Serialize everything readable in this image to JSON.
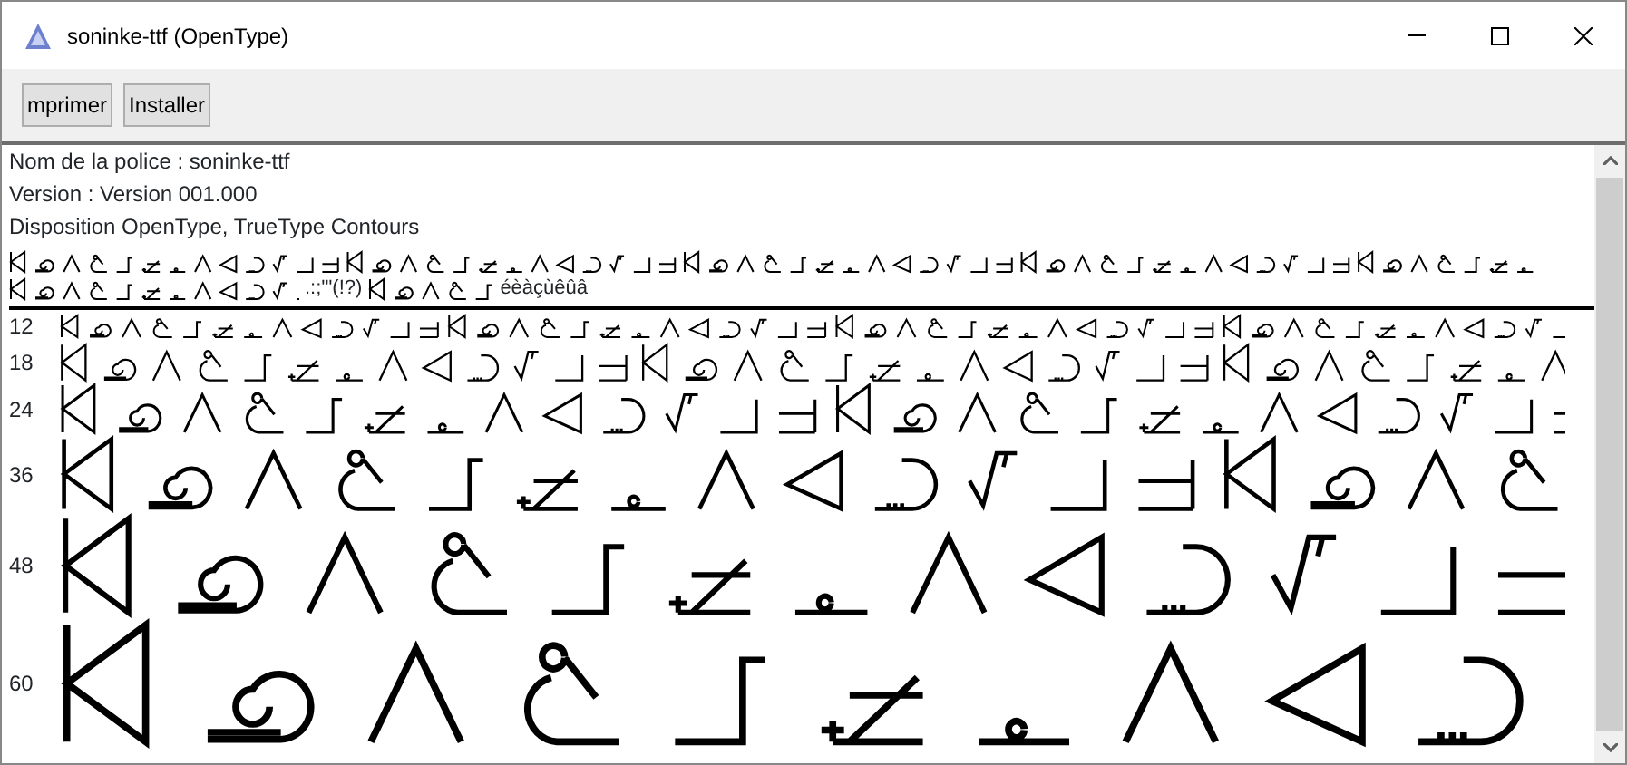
{
  "window": {
    "title": "soninke-ttf (OpenType)"
  },
  "toolbar": {
    "buttons": [
      "mprimer",
      "Installer"
    ]
  },
  "font_info": [
    "Nom de la police : soninke-ttf",
    "Version : Version 001.000",
    "Disposition OpenType, TrueType  Contours"
  ],
  "character_set": {
    "punctuation": ".:;'\"(!?)",
    "accented": "éèàçùêûâ"
  },
  "samples": [
    {
      "size": "12"
    },
    {
      "size": "18"
    },
    {
      "size": "24"
    },
    {
      "size": "36"
    },
    {
      "size": "48"
    },
    {
      "size": "60"
    }
  ]
}
